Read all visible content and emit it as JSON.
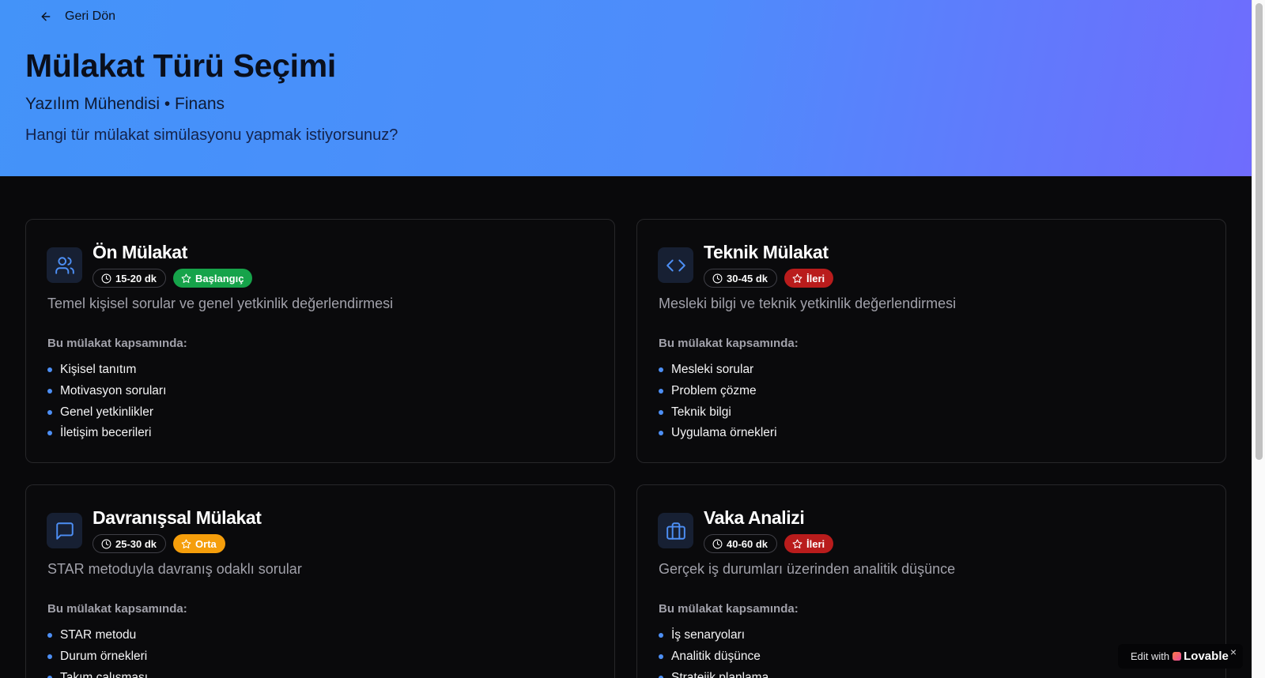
{
  "header": {
    "back_label": "Geri Dön",
    "title": "Mülakat Türü Seçimi",
    "subtitle": "Yazılım Mühendisi • Finans",
    "question": "Hangi tür mülakat simülasyonu yapmak istiyorsunuz?"
  },
  "coverage_label": "Bu mülakat kapsamında:",
  "cards": [
    {
      "title": "Ön Mülakat",
      "icon": "users-icon",
      "duration": "15-20 dk",
      "level": "Başlangıç",
      "level_color": "#16a34a",
      "description": "Temel kişisel sorular ve genel yetkinlik değerlendirmesi",
      "items": [
        "Kişisel tanıtım",
        "Motivasyon soruları",
        "Genel yetkinlikler",
        "İletişim becerileri"
      ]
    },
    {
      "title": "Teknik Mülakat",
      "icon": "code-icon",
      "duration": "30-45 dk",
      "level": "İleri",
      "level_color": "#b91c1c",
      "description": "Mesleki bilgi ve teknik yetkinlik değerlendirmesi",
      "items": [
        "Mesleki sorular",
        "Problem çözme",
        "Teknik bilgi",
        "Uygulama örnekleri"
      ]
    },
    {
      "title": "Davranışsal Mülakat",
      "icon": "message-square-icon",
      "duration": "25-30 dk",
      "level": "Orta",
      "level_color": "#f59e0b",
      "description": "STAR metoduyla davranış odaklı sorular",
      "items": [
        "STAR metodu",
        "Durum örnekleri",
        "Takım çalışması"
      ]
    },
    {
      "title": "Vaka Analizi",
      "icon": "briefcase-icon",
      "duration": "40-60 dk",
      "level": "İleri",
      "level_color": "#b91c1c",
      "description": "Gerçek iş durumları üzerinden analitik düşünce",
      "items": [
        "İş senaryoları",
        "Analitik düşünce",
        "Stratejik planlama"
      ]
    }
  ],
  "badge": {
    "edit_with": "Edit with",
    "brand": "Lovable",
    "close": "×"
  },
  "colors": {
    "accent": "#4d8ff5",
    "gradient_start": "#4393f9",
    "gradient_end": "#6f6cfd",
    "background": "#09090b"
  }
}
